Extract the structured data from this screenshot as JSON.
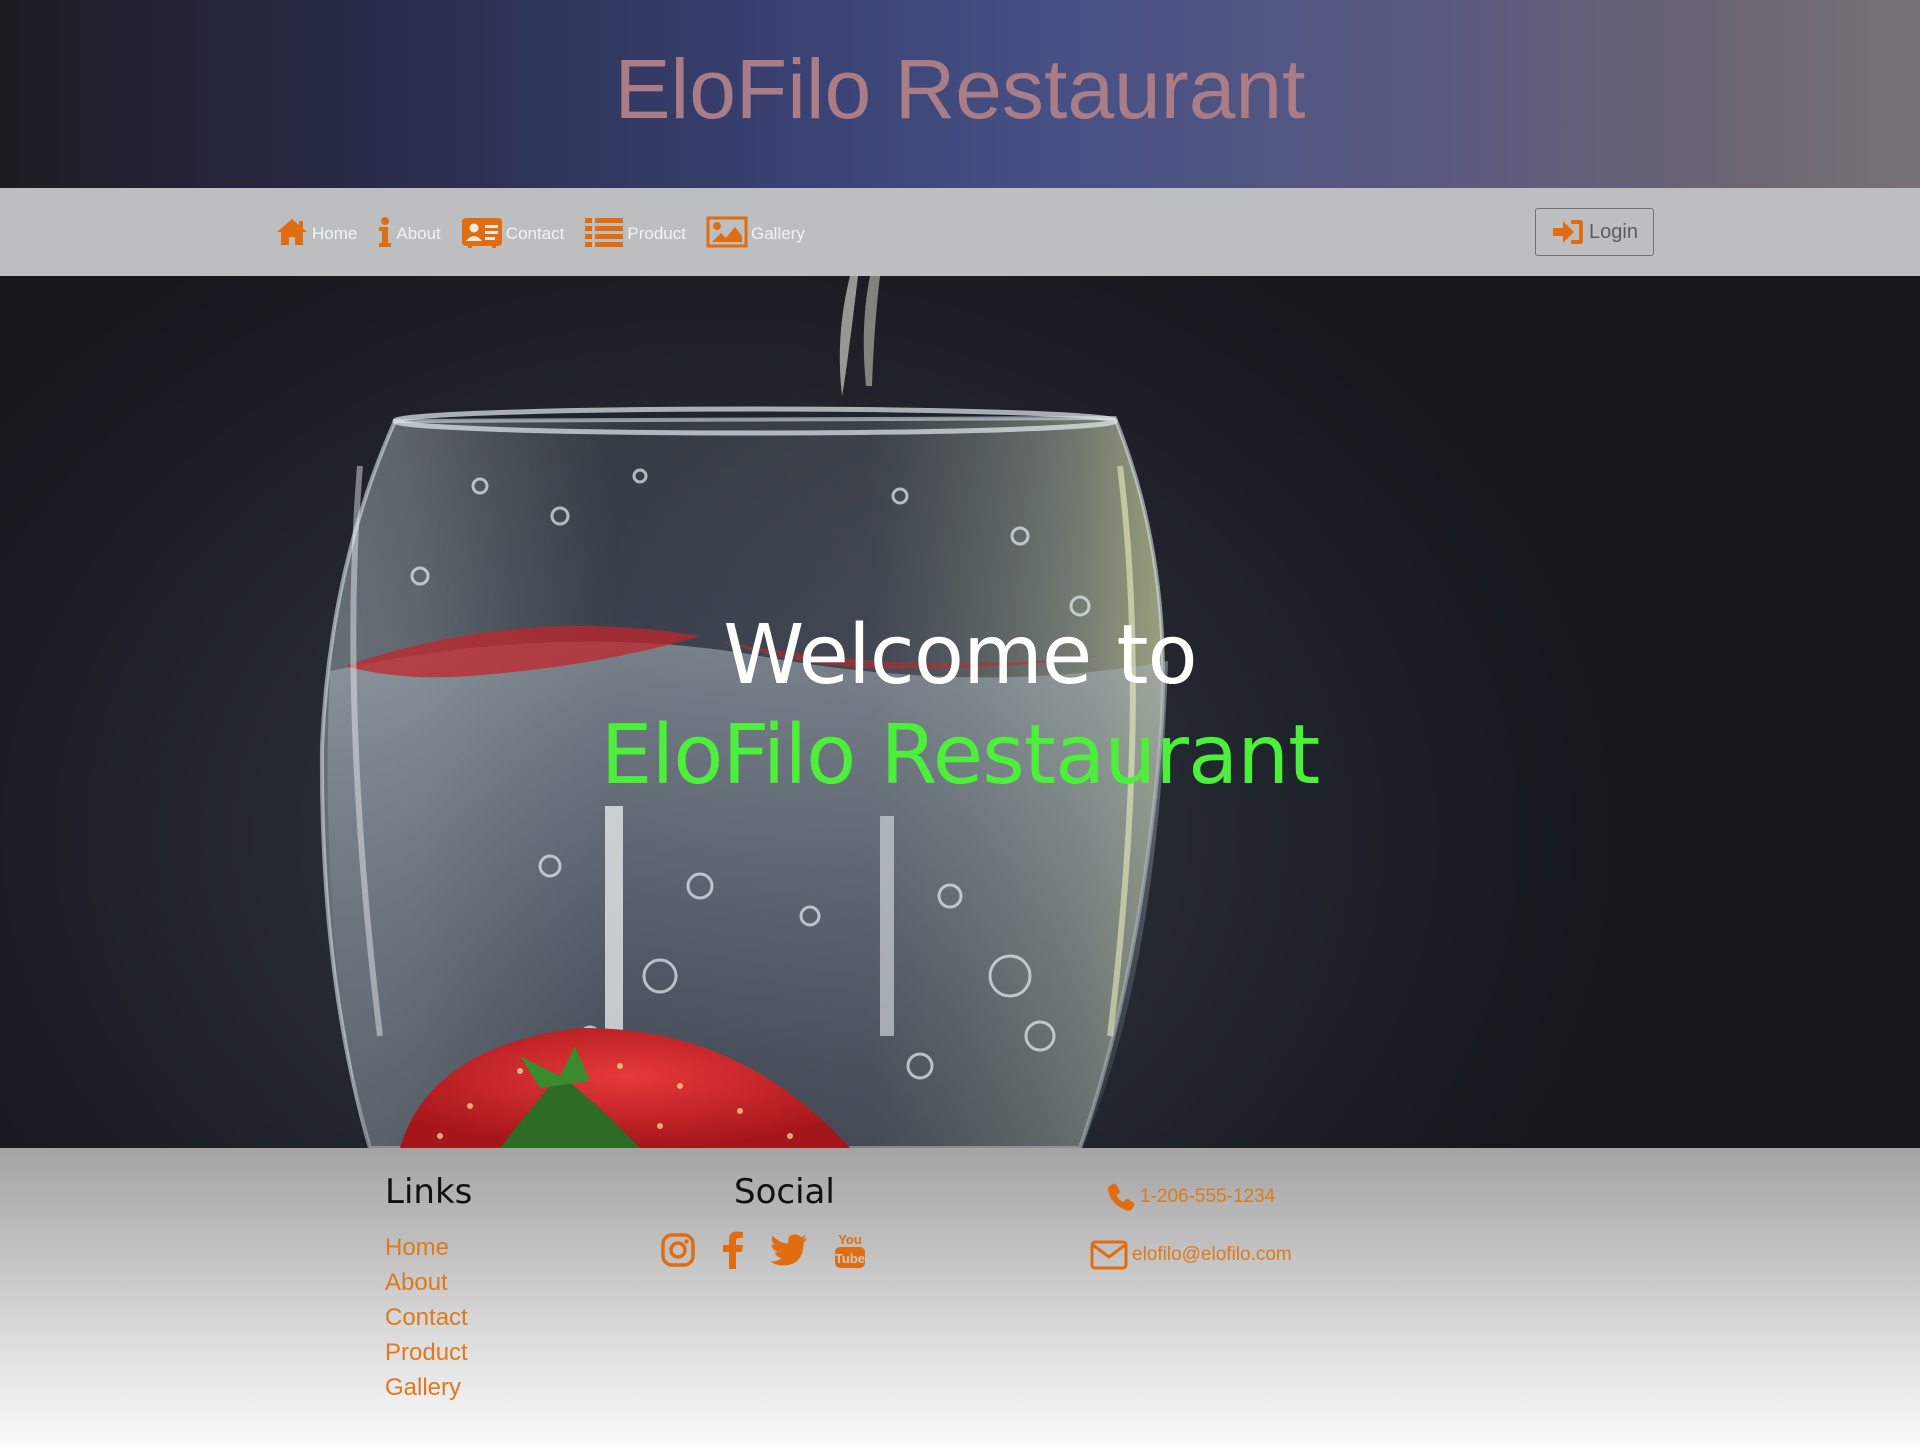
{
  "header": {
    "title": "EloFilo Restaurant"
  },
  "nav": {
    "items": [
      {
        "label": "Home",
        "icon": "home-icon"
      },
      {
        "label": "About",
        "icon": "info-icon"
      },
      {
        "label": "Contact",
        "icon": "contact-card-icon"
      },
      {
        "label": "Product",
        "icon": "list-icon"
      },
      {
        "label": "Gallery",
        "icon": "image-icon"
      }
    ],
    "login_label": "Login",
    "login_icon": "sign-in-icon"
  },
  "hero": {
    "line1": "Welcome to",
    "line2": "EloFilo Restaurant"
  },
  "footer": {
    "links_heading": "Links",
    "links": [
      "Home",
      "About",
      "Contact",
      "Product",
      "Gallery"
    ],
    "social_heading": "Social",
    "social": [
      "instagram-icon",
      "facebook-icon",
      "twitter-icon",
      "youtube-icon"
    ],
    "phone": "1-206-555-1234",
    "email": "elofilo@elofilo.com"
  },
  "colors": {
    "accent": "#de7a1b",
    "hero_highlight": "#4cf03a",
    "title": "#a97c86",
    "navbar_bg": "#bdbec0"
  }
}
